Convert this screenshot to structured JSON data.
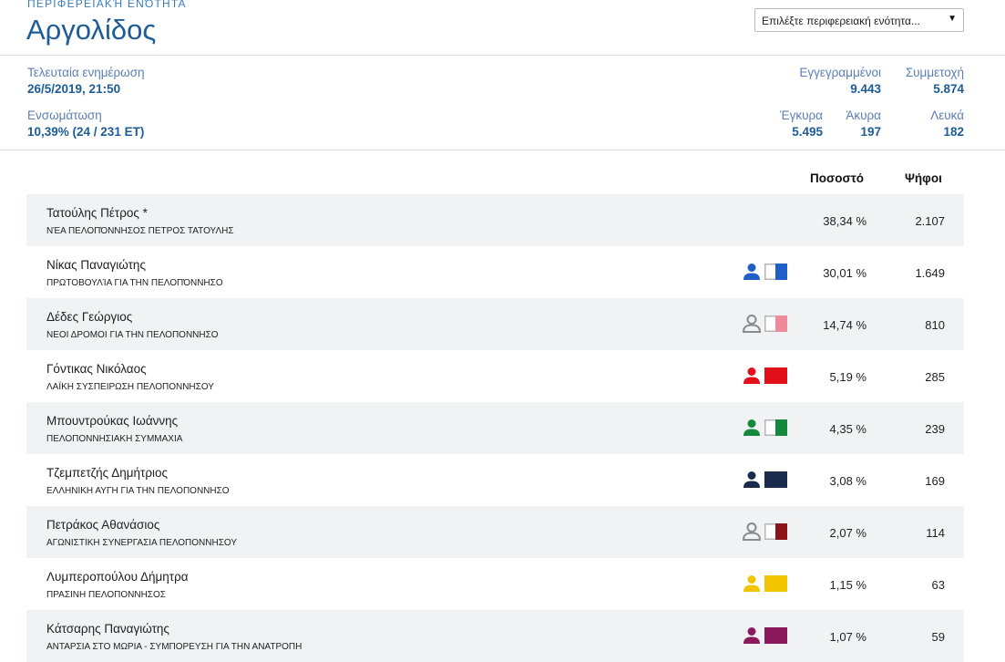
{
  "header": {
    "region_label": "Περιφερειακή Ενότητα",
    "region_title": "Αργολίδος",
    "selector_text": "Επιλέξτε περιφερειακή ενότητα...",
    "selector_arrow": "▼"
  },
  "stats": {
    "last_update_label": "Τελευταία ενημέρωση",
    "last_update_value": "26/5/2019, 21:50",
    "integration_label": "Ενσωμάτωση",
    "integration_value": "10,39% (24 / 231 ΕΤ)",
    "registered_label": "Εγγεγραμμένοι",
    "registered_value": "9.443",
    "turnout_label": "Συμμετοχή",
    "turnout_value": "5.874",
    "valid_label": "Έγκυρα",
    "valid_value": "5.495",
    "invalid_label": "Άκυρα",
    "invalid_value": "197",
    "blank_label": "Λευκά",
    "blank_value": "182"
  },
  "table": {
    "percent_header": "Ποσοστό",
    "votes_header": "Ψήφοι",
    "rows": [
      {
        "name": "Τατούλης Πέτρος *",
        "party": "Νέα Πελοπόννησος ΠΕΤΡΟΣ ΤΑΤΟΥΛΗΣ",
        "percent": "38,34 %",
        "votes": "2.107",
        "person_icon": "",
        "person_color": "",
        "flag_color": "",
        "flag_half": false
      },
      {
        "name": "Νίκας Παναγιώτης",
        "party": "Πρωτοβουλία για την Πελοπόννησο",
        "percent": "30,01 %",
        "votes": "1.649",
        "person_icon": "person-icon",
        "person_color": "#1f5fc7",
        "flag_color": "#1f5fc7",
        "flag_half": true
      },
      {
        "name": "Δέδες Γεώργιος",
        "party": "ΝΕΟΙ ΔΡΟΜΟΙ ΓΙΑ ΤΗΝ ΠΕΛΟΠΟΝΝΗΣΟ",
        "percent": "14,74 %",
        "votes": "810",
        "person_icon": "person-outline-icon",
        "person_color": "#8a8a8a",
        "flag_color": "#ee8a9a",
        "flag_half": true
      },
      {
        "name": "Γόντικας Νικόλαος",
        "party": "ΛΑΪΚΗ ΣΥΣΠΕΙΡΩΣΗ ΠΕΛΟΠΟΝΝΗΣΟΥ",
        "percent": "5,19 %",
        "votes": "285",
        "person_icon": "person-icon",
        "person_color": "#e2101a",
        "flag_color": "#e2101a",
        "flag_half": false
      },
      {
        "name": "Μπουντρούκας Ιωάννης",
        "party": "ΠΕΛΟΠΟΝΝΗΣΙΑΚΗ ΣΥΜΜΑΧΙΑ",
        "percent": "4,35 %",
        "votes": "239",
        "person_icon": "person-icon",
        "person_color": "#15893b",
        "flag_color": "#15893b",
        "flag_half": true
      },
      {
        "name": "Τζεμπετζής Δημήτριος",
        "party": "ΕΛΛΗΝΙΚΗ ΑΥΓΗ ΓΙΑ ΤΗΝ ΠΕΛΟΠΟΝΝΗΣΟ",
        "percent": "3,08 %",
        "votes": "169",
        "person_icon": "person-icon",
        "person_color": "#1b2b4b",
        "flag_color": "#1b2b4b",
        "flag_half": false
      },
      {
        "name": "Πετράκος Αθανάσιος",
        "party": "ΑΓΩΝΙΣΤΙΚΗ ΣΥΝΕΡΓΑΣΙΑ ΠΕΛΟΠΟΝΝΗΣΟΥ",
        "percent": "2,07 %",
        "votes": "114",
        "person_icon": "person-outline-icon",
        "person_color": "#8a8a8a",
        "flag_color": "#8b1418",
        "flag_half": true
      },
      {
        "name": "Λυμπεροπούλου Δήμητρα",
        "party": "ΠΡΑΣΙΝΗ ΠΕΛΟΠΟΝΝΗΣΟΣ",
        "percent": "1,15 %",
        "votes": "63",
        "person_icon": "person-icon",
        "person_color": "#f2c500",
        "flag_color": "#f2c500",
        "flag_half": false
      },
      {
        "name": "Κάτσαρης Παναγιώτης",
        "party": "ΑΝΤΑΡΣΙΑ ΣΤΟ ΜΩΡΙΑ - ΣΥΜΠΟΡΕΥΣΗ ΓΙΑ ΤΗΝ ΑΝΑΤΡΟΠΗ",
        "percent": "1,07 %",
        "votes": "59",
        "person_icon": "person-icon",
        "person_color": "#8b1a5c",
        "flag_color": "#8b1a5c",
        "flag_half": false
      }
    ]
  }
}
